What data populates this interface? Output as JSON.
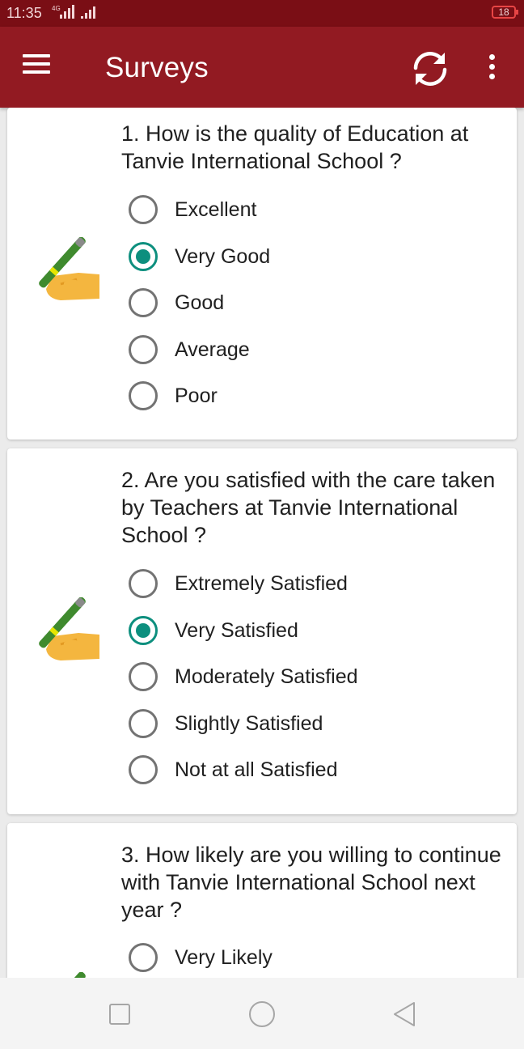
{
  "status": {
    "time": "11:35",
    "network": "4G",
    "battery": "18"
  },
  "appbar": {
    "title": "Surveys",
    "menu_icon": "menu-icon",
    "refresh_icon": "refresh-icon",
    "more_icon": "more-vert-icon"
  },
  "colors": {
    "status_bar": "#7a0e15",
    "app_bar": "#921a22",
    "accent": "#0d8f7e",
    "background": "#ebebeb"
  },
  "questions": [
    {
      "text": "1. How is the quality of Education at Tanvie International School ?",
      "selected": "Very Good",
      "options": [
        "Excellent",
        "Very Good",
        "Good",
        "Average",
        "Poor"
      ]
    },
    {
      "text": "2. Are you satisfied with the care taken by Teachers at Tanvie International School ?",
      "selected": "Very Satisfied",
      "options": [
        "Extremely Satisfied",
        "Very Satisfied",
        "Moderately Satisfied",
        "Slightly Satisfied",
        "Not at all Satisfied"
      ]
    },
    {
      "text": "3. How likely are you willing to continue with Tanvie International School next year ?",
      "selected": null,
      "options": [
        "Very Likely"
      ]
    }
  ],
  "navbar": {
    "icons": [
      "recent-apps-icon",
      "home-icon",
      "back-icon"
    ]
  }
}
